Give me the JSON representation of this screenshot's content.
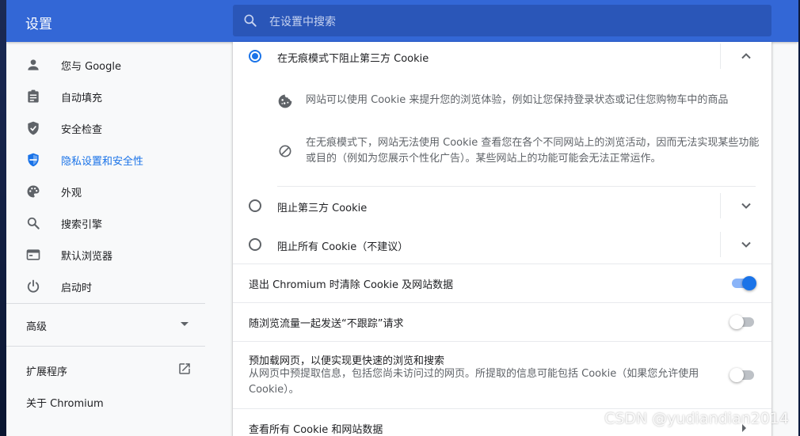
{
  "header": {
    "title": "设置",
    "search_placeholder": "在设置中搜索"
  },
  "sidebar": {
    "items": [
      {
        "label": "您与 Google",
        "icon": "person-icon"
      },
      {
        "label": "自动填充",
        "icon": "clipboard-icon"
      },
      {
        "label": "安全检查",
        "icon": "shield-check-icon"
      },
      {
        "label": "隐私设置和安全性",
        "icon": "shield-icon",
        "active": true
      },
      {
        "label": "外观",
        "icon": "palette-icon"
      },
      {
        "label": "搜索引擎",
        "icon": "search-icon"
      },
      {
        "label": "默认浏览器",
        "icon": "browser-icon"
      },
      {
        "label": "启动时",
        "icon": "power-icon"
      }
    ],
    "advanced_label": "高级",
    "extensions_label": "扩展程序",
    "about_label": "关于 Chromium"
  },
  "cookies": {
    "options": [
      {
        "label": "在无痕模式下阻止第三方 Cookie",
        "checked": true,
        "expanded": true
      },
      {
        "label": "阻止第三方 Cookie",
        "checked": false,
        "expanded": false
      },
      {
        "label": "阻止所有 Cookie（不建议）",
        "checked": false,
        "expanded": false
      }
    ],
    "details": [
      {
        "icon": "cookie-icon",
        "text": "网站可以使用 Cookie 来提升您的浏览体验，例如让您保持登录状态或记住您购物车中的商品"
      },
      {
        "icon": "block-icon",
        "text": "在无痕模式下，网站无法使用 Cookie 查看您在各个不同网站上的浏览活动，因而无法实现某些功能或目的（例如为您展示个性化广告）。某些网站上的功能可能会无法正常运作。"
      }
    ]
  },
  "settings": {
    "clear_on_exit": {
      "label": "退出 Chromium 时清除 Cookie 及网站数据",
      "enabled": true
    },
    "do_not_track": {
      "label": "随浏览流量一起发送“不跟踪”请求",
      "enabled": false
    },
    "preload": {
      "label": "预加载网页，以便实现更快速的浏览和搜索",
      "sublabel": "从网页中预提取信息，包括您尚未访问过的网页。所提取的信息可能包括 Cookie（如果您允许使用 Cookie）。",
      "enabled": false
    },
    "see_all_cookies": {
      "label": "查看所有 Cookie 和网站数据"
    }
  },
  "watermark": "CSDN @yudiandian2014",
  "colors": {
    "header": "#3367d6",
    "accent": "#1a73e8",
    "background": "#f8f9fa"
  }
}
